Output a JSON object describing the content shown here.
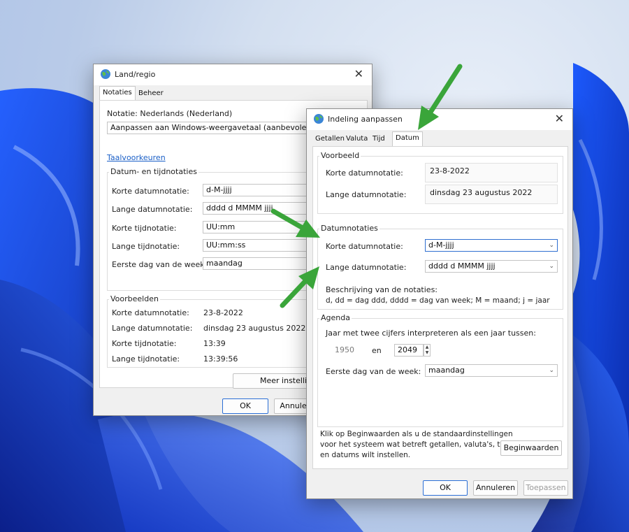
{
  "back_dialog": {
    "title": "Land/regio",
    "tabs": [
      "Notaties",
      "Beheer"
    ],
    "notatie_label": "Notatie: Nederlands (Nederland)",
    "format_select": "Aanpassen aan Windows-weergavetaal (aanbevolen)",
    "taalvoorkeuren_link": "Taalvoorkeuren",
    "datetime_group_title": "Datum- en tijdnotaties",
    "formats": [
      {
        "label": "Korte datumnotatie:",
        "value": "d-M-jjjj"
      },
      {
        "label": "Lange datumnotatie:",
        "value": "dddd d MMMM jjjj"
      },
      {
        "label": "Korte tijdnotatie:",
        "value": "UU:mm"
      },
      {
        "label": "Lange tijdnotatie:",
        "value": "UU:mm:ss"
      },
      {
        "label": "Eerste dag van de week:",
        "value": "maandag"
      }
    ],
    "examples_group_title": "Voorbeelden",
    "examples": [
      {
        "label": "Korte datumnotatie:",
        "value": "23-8-2022"
      },
      {
        "label": "Lange datumnotatie:",
        "value": "dinsdag 23 augustus 2022"
      },
      {
        "label": "Korte tijdnotatie:",
        "value": "13:39"
      },
      {
        "label": "Lange tijdnotatie:",
        "value": "13:39:56"
      }
    ],
    "more_settings_button": "Meer instelling",
    "ok_button": "OK",
    "cancel_button": "Annulere"
  },
  "front_dialog": {
    "title": "Indeling aanpassen",
    "tabs": [
      "Getallen",
      "Valuta",
      "Tijd",
      "Datum"
    ],
    "voorbeeld_title": "Voorbeeld",
    "preview": [
      {
        "label": "Korte datumnotatie:",
        "value": "23-8-2022"
      },
      {
        "label": "Lange datumnotatie:",
        "value": "dinsdag 23 augustus 2022"
      }
    ],
    "datumnotaties_title": "Datumnotaties",
    "short_date_label": "Korte datumnotatie:",
    "short_date_value": "d-M-jjjj",
    "long_date_label": "Lange datumnotatie:",
    "long_date_value": "dddd d MMMM jjjj",
    "description_title": "Beschrijving van de notaties:",
    "description_text": "d, dd = dag  ddd, dddd = dag van week;  M = maand;  j = jaar",
    "agenda_title": "Agenda",
    "two_digit_label": "Jaar met twee cijfers interpreteren als een jaar tussen:",
    "year_from": "1950",
    "year_and": "en",
    "year_to": "2049",
    "first_day_label": "Eerste dag van de week:",
    "first_day_value": "maandag",
    "reset_text_lines": [
      "Klik op Beginwaarden als u de standaardinstellingen",
      "voor het systeem wat betreft getallen, valuta's, tijden",
      "en datums wilt instellen."
    ],
    "reset_button": "Beginwaarden",
    "ok_button": "OK",
    "cancel_button": "Annuleren",
    "apply_button": "Toepassen"
  },
  "colors": {
    "arrow": "#3aa53a",
    "accent": "#2b6fd6",
    "link": "#1a5fc7"
  },
  "icons": [
    "globe-icon",
    "close-icon",
    "chevron-down-icon",
    "spin-up-icon",
    "spin-down-icon",
    "annotation-arrow"
  ]
}
